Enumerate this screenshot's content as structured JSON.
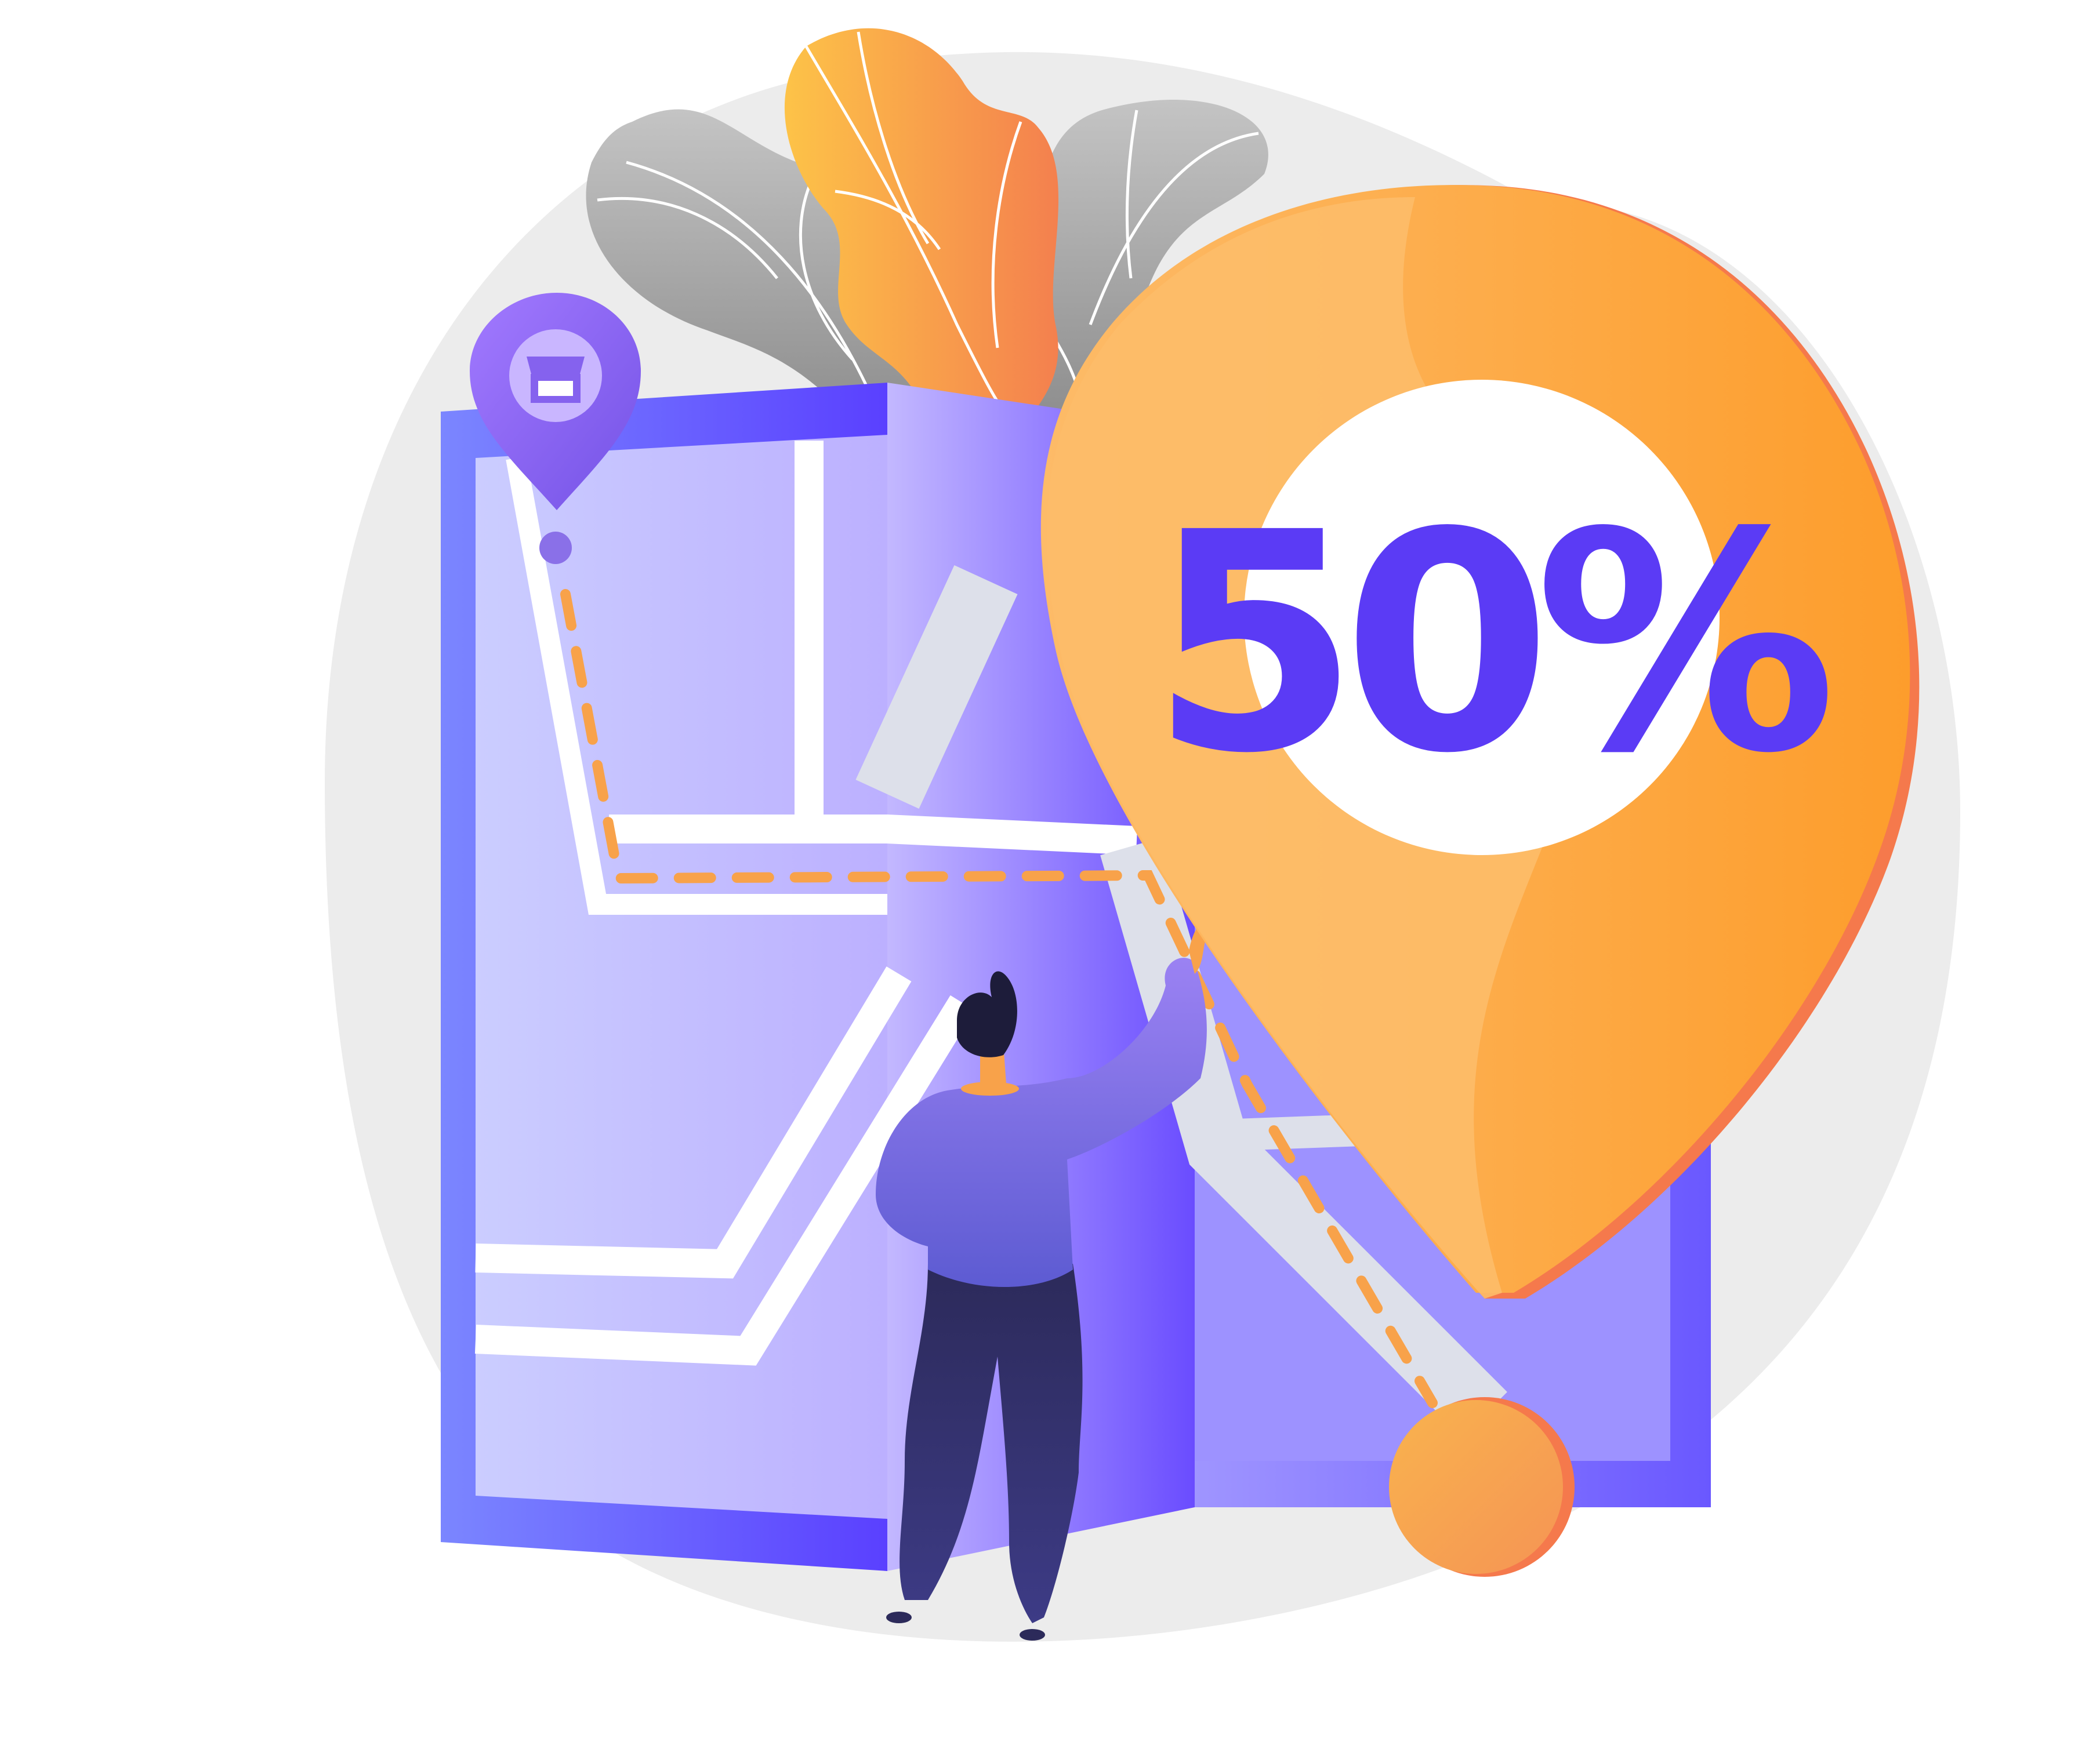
{
  "promo": {
    "discount_label": "50%"
  },
  "icons": {
    "store_pin": "store-icon",
    "destination_pin": "map-pin-icon"
  },
  "colors": {
    "map_primary": "#6b5cff",
    "map_light": "#c6c3ff",
    "pin_orange": "#fca33a",
    "pin_light": "#fdbd69",
    "discount_text": "#5b3bf5",
    "route_dash": "#f8a24a",
    "background_blob": "#ececec"
  }
}
